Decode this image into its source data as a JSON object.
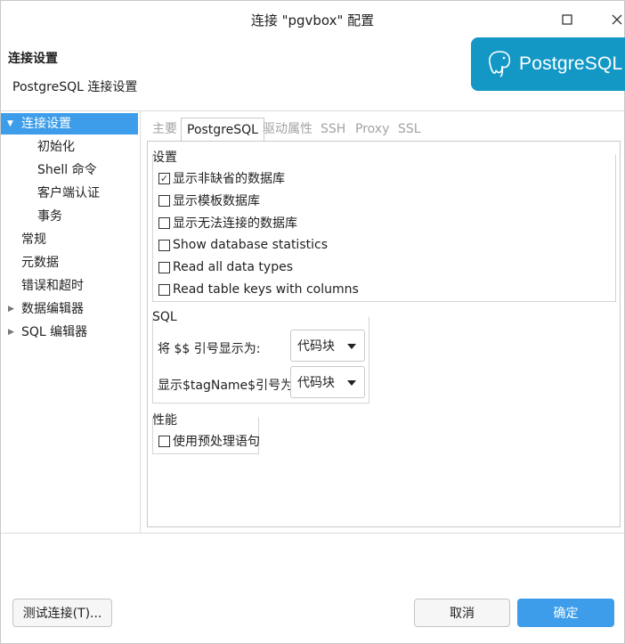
{
  "window": {
    "title": "连接 \"pgvbox\" 配置",
    "controls": {
      "minimize": "□",
      "maximize": "□",
      "close": "✕"
    }
  },
  "header": {
    "title": "连接设置",
    "subtitle": "PostgreSQL 连接设置",
    "logo_text": "PostgreSQL",
    "logo_color": "#1398c6"
  },
  "tree": {
    "items": [
      {
        "label": "连接设置",
        "selected": true,
        "expandable": true,
        "expanded": true
      },
      {
        "label": "初始化"
      },
      {
        "label": "Shell 命令"
      },
      {
        "label": "客户端认证"
      },
      {
        "label": "事务"
      },
      {
        "label": "常规"
      },
      {
        "label": "元数据"
      },
      {
        "label": "错误和超时"
      },
      {
        "label": "数据编辑器",
        "expandable": true
      },
      {
        "label": "SQL 编辑器",
        "expandable": true
      }
    ]
  },
  "tabs": [
    {
      "label": "主要"
    },
    {
      "label": "PostgreSQL",
      "active": true
    },
    {
      "label": "驱动属性"
    },
    {
      "label": "SSH"
    },
    {
      "label": "Proxy"
    },
    {
      "label": "SSL"
    }
  ],
  "settings": {
    "group_label": "设置",
    "options": [
      {
        "label": "显示非缺省的数据库",
        "checked": true
      },
      {
        "label": "显示模板数据库",
        "checked": false
      },
      {
        "label": "显示无法连接的数据库",
        "checked": false
      },
      {
        "label": "Show database statistics",
        "checked": false
      },
      {
        "label": "Read all data types",
        "checked": false
      },
      {
        "label": "Read table keys with columns",
        "checked": false
      }
    ]
  },
  "sql": {
    "group_label": "SQL",
    "dollar_label": "将 $$ 引号显示为:",
    "dollar_value": "代码块",
    "tag_label": "显示$tagName$引号为:",
    "tag_value": "代码块"
  },
  "performance": {
    "group_label": "性能",
    "option": {
      "label": "使用预处理语句",
      "checked": false
    }
  },
  "buttons": {
    "test": "测试连接(T)...",
    "cancel": "取消",
    "ok": "确定"
  },
  "colors": {
    "accent": "#3d9dea"
  }
}
